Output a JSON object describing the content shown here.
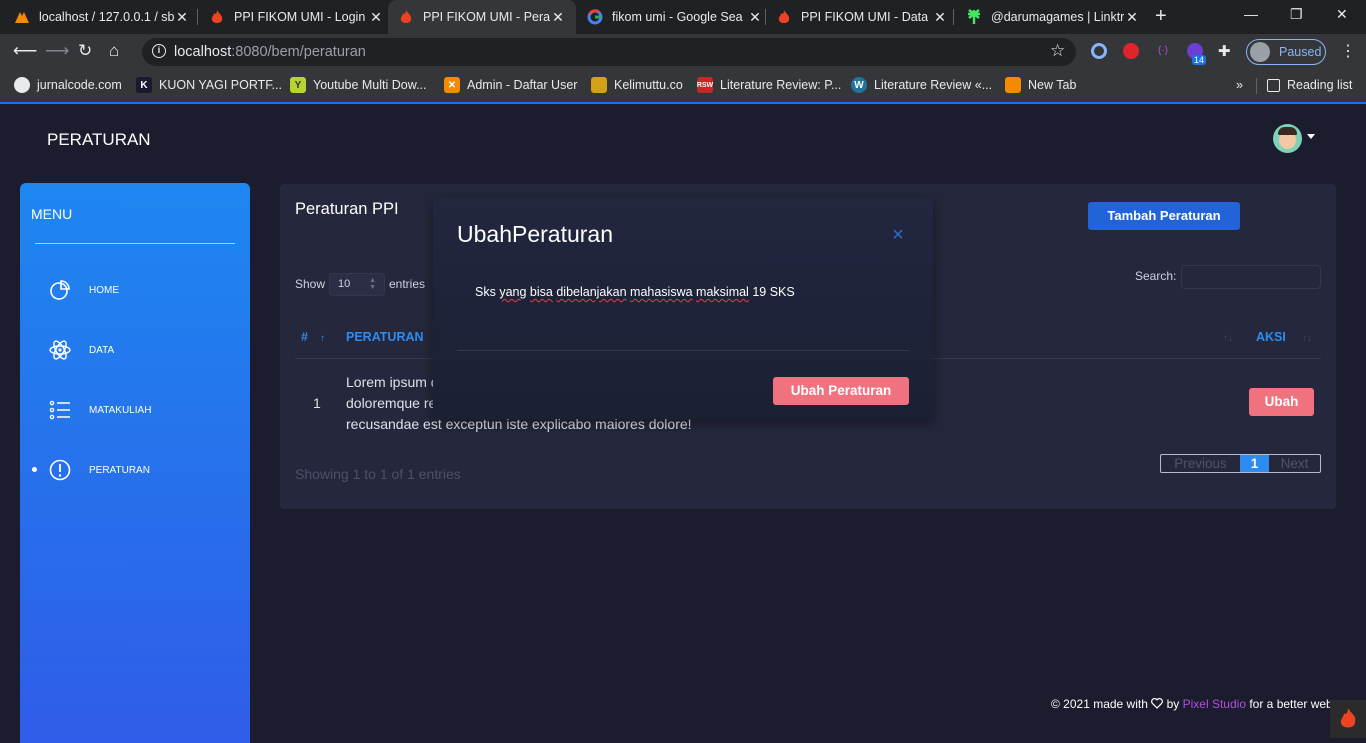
{
  "browser": {
    "tabs": [
      {
        "title": "localhost / 127.0.0.1 / sb",
        "icon": "xampp-icon"
      },
      {
        "title": "PPI FIKOM UMI - Login",
        "icon": "codeigniter-icon"
      },
      {
        "title": "PPI FIKOM UMI - Peratu",
        "icon": "codeigniter-icon",
        "active": true
      },
      {
        "title": "fikom umi - Google Sea",
        "icon": "google-icon"
      },
      {
        "title": "PPI FIKOM UMI - Data",
        "icon": "codeigniter-icon"
      },
      {
        "title": "@darumagames | Linktr",
        "icon": "linktree-icon"
      }
    ],
    "url_host": "localhost",
    "url_rest": ":8080/bem/peraturan",
    "profile_status": "Paused",
    "extension_badge": "14",
    "bookmarks": [
      {
        "label": "jurnalcode.com",
        "icon": "globe-icon"
      },
      {
        "label": "KUON YAGI PORTF...",
        "icon": "k-icon"
      },
      {
        "label": "Youtube Multi Dow...",
        "icon": "y-icon"
      },
      {
        "label": "Admin - Daftar User",
        "icon": "xampp-icon"
      },
      {
        "label": "Kelimuttu.co",
        "icon": "pineapple-icon"
      },
      {
        "label": "Literature Review: P...",
        "icon": "rsw-icon"
      },
      {
        "label": "Literature Review «...",
        "icon": "wordpress-icon"
      },
      {
        "label": "New Tab",
        "icon": "xampp-icon"
      }
    ],
    "reading_list": "Reading list"
  },
  "header": {
    "title": "PERATURAN"
  },
  "sidebar": {
    "title": "MENU",
    "items": [
      {
        "label": "HOME",
        "icon": "pie-chart-icon"
      },
      {
        "label": "DATA",
        "icon": "atom-icon"
      },
      {
        "label": "MATAKULIAH",
        "icon": "list-icon"
      },
      {
        "label": "PERATURAN",
        "icon": "alert-circle-icon",
        "active": true
      }
    ]
  },
  "card": {
    "title": "Peraturan PPI",
    "add_button": "Tambah Peraturan",
    "show_label": "Show",
    "entries_value": "10",
    "entries_label": "entries",
    "search_label": "Search:",
    "search_value": "",
    "columns": [
      "#",
      "PERATURAN",
      "AKSI"
    ],
    "rows": [
      {
        "num": "1",
        "text": "Lorem ipsum d",
        "text_line2": "doloremque re",
        "text_line3": "recusandae est exceptun iste explicabo maiores dolore!",
        "action": "Ubah"
      }
    ],
    "showing": "Showing 1 to 1 of 1 entries",
    "pagination": {
      "previous": "Previous",
      "page": "1",
      "next": "Next"
    }
  },
  "modal": {
    "title": "UbahPeraturan",
    "close": "×",
    "body_words": [
      "Sks",
      "yang",
      "bisa",
      "dibelanjakan",
      "mahasiswa",
      "maksimal",
      "19",
      "SKS"
    ],
    "submit": "Ubah Peraturan"
  },
  "footer": {
    "prefix": "© 2021 made with",
    "by": "by",
    "studio": "Pixel Studio",
    "suffix": "for a better web"
  },
  "colors": {
    "sidebar_top": "#1e87f0",
    "sidebar_bottom": "#2f5ce8",
    "primary": "#2264d8",
    "accent_pink": "#f0727f",
    "table_header": "#2d8cf0",
    "background": "#1b1d2e"
  }
}
